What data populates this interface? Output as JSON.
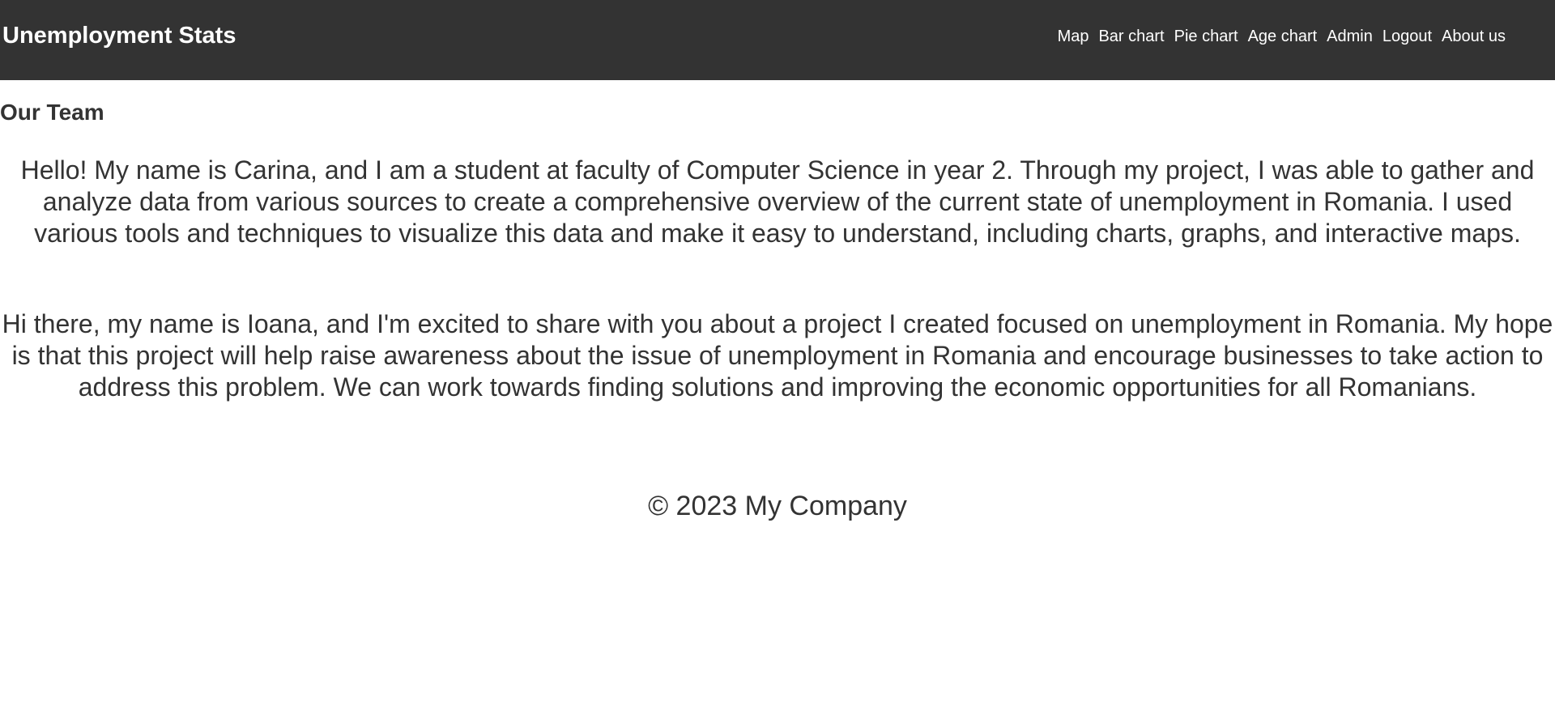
{
  "header": {
    "brand": "Unemployment Stats",
    "nav": [
      {
        "label": "Map"
      },
      {
        "label": "Bar chart"
      },
      {
        "label": "Pie chart"
      },
      {
        "label": "Age chart"
      },
      {
        "label": "Admin"
      },
      {
        "label": "Logout"
      },
      {
        "label": "About us"
      }
    ]
  },
  "main": {
    "title": "Our Team",
    "paragraphs": [
      "Hello! My name is Carina, and I am a student at faculty of Computer Science in year 2. Through my project, I was able to gather and analyze data from various sources to create a comprehensive overview of the current state of unemployment in Romania. I used various tools and techniques to visualize this data and make it easy to understand, including charts, graphs, and interactive maps.",
      "Hi there, my name is Ioana, and I'm excited to share with you about a project I created focused on unemployment in Romania. My hope is that this project will help raise awareness about the issue of unemployment in Romania and encourage businesses to take action to address this problem. We can work towards finding solutions and improving the economic opportunities for all Romanians."
    ]
  },
  "footer": {
    "text": "© 2023 My Company"
  },
  "colors": {
    "navbar_bg": "#333333",
    "nav_text": "#ffffff",
    "body_text": "#333333",
    "page_bg": "#ffffff"
  }
}
